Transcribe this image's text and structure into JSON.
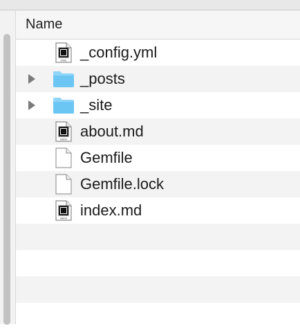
{
  "columns": {
    "name_header": "Name"
  },
  "files": [
    {
      "name": "_config.yml",
      "kind": "doc",
      "badge": "YAML",
      "expandable": false
    },
    {
      "name": "_posts",
      "kind": "folder",
      "badge": "",
      "expandable": true
    },
    {
      "name": "_site",
      "kind": "folder",
      "badge": "",
      "expandable": true
    },
    {
      "name": "about.md",
      "kind": "doc",
      "badge": "MARK",
      "expandable": false
    },
    {
      "name": "Gemfile",
      "kind": "blank",
      "badge": "",
      "expandable": false
    },
    {
      "name": "Gemfile.lock",
      "kind": "blank",
      "badge": "",
      "expandable": false
    },
    {
      "name": "index.md",
      "kind": "doc",
      "badge": "MARK",
      "expandable": false
    }
  ],
  "colors": {
    "folder": "#6cc6f4",
    "folder_tab": "#8fd5f8",
    "row_alt": "#f3f3f3",
    "disclosure": "#7a7a7a"
  }
}
